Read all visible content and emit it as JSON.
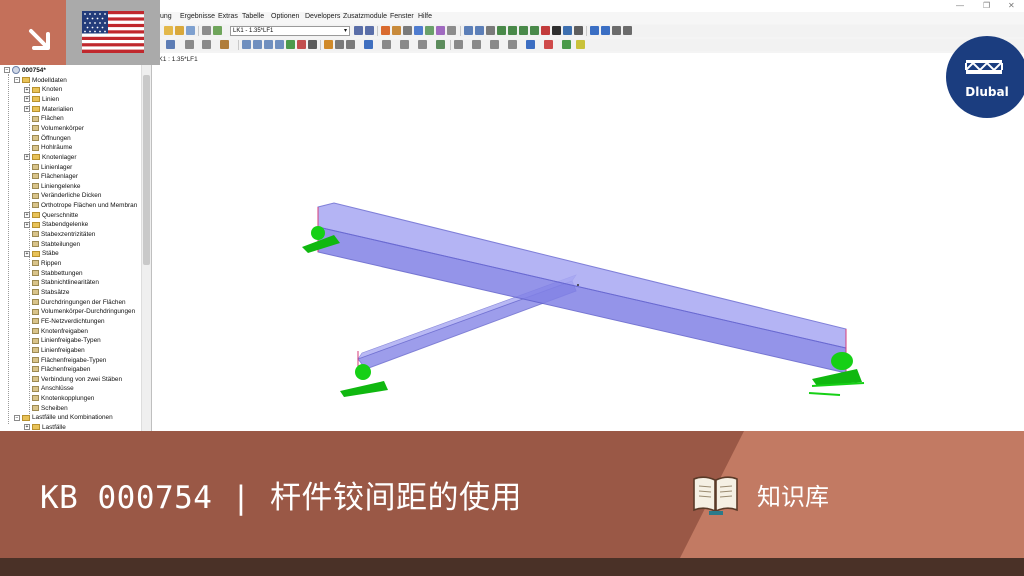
{
  "window": {
    "minimize": "—",
    "restore": "❐",
    "close": "✕"
  },
  "menu": [
    {
      "key": "ergebnisse",
      "label": "Ergebnisse"
    },
    {
      "key": "extras",
      "label": "Extras"
    },
    {
      "key": "tabelle",
      "label": "Tabelle"
    },
    {
      "key": "optionen",
      "label": "Optionen"
    },
    {
      "key": "developers",
      "label": "Developers"
    },
    {
      "key": "zusatzmodule",
      "label": "Zusatzmodule"
    },
    {
      "key": "fenster",
      "label": "Fenster"
    },
    {
      "key": "hilfe",
      "label": "Hilfe"
    }
  ],
  "menu_partial": "ung",
  "toolbar": {
    "load_case_select": "LK1 - 1.35*LF1",
    "dropdown_arrow": "▾"
  },
  "viewport": {
    "label": "LK1 : 1.35*LF1"
  },
  "navigator": {
    "root": "000754*",
    "items": [
      {
        "label": "Modelldaten",
        "level": 1,
        "type": "folder",
        "exp": "−"
      },
      {
        "label": "Knoten",
        "level": 2,
        "type": "folder",
        "exp": "+"
      },
      {
        "label": "Linien",
        "level": 2,
        "type": "folder",
        "exp": "+"
      },
      {
        "label": "Materialien",
        "level": 2,
        "type": "folder",
        "exp": "+"
      },
      {
        "label": "Flächen",
        "level": 2,
        "type": "leaf",
        "exp": ""
      },
      {
        "label": "Volumenkörper",
        "level": 2,
        "type": "leaf",
        "exp": ""
      },
      {
        "label": "Öffnungen",
        "level": 2,
        "type": "leaf",
        "exp": ""
      },
      {
        "label": "Hohlräume",
        "level": 2,
        "type": "leaf",
        "exp": ""
      },
      {
        "label": "Knotenlager",
        "level": 2,
        "type": "folder",
        "exp": "+"
      },
      {
        "label": "Linienlager",
        "level": 2,
        "type": "leaf",
        "exp": ""
      },
      {
        "label": "Flächenlager",
        "level": 2,
        "type": "leaf",
        "exp": ""
      },
      {
        "label": "Liniengelenke",
        "level": 2,
        "type": "leaf",
        "exp": ""
      },
      {
        "label": "Veränderliche Dicken",
        "level": 2,
        "type": "leaf",
        "exp": ""
      },
      {
        "label": "Orthotrope Flächen und Membran",
        "level": 2,
        "type": "leaf",
        "exp": ""
      },
      {
        "label": "Querschnitte",
        "level": 2,
        "type": "folder",
        "exp": "+"
      },
      {
        "label": "Stabendgelenke",
        "level": 2,
        "type": "folder",
        "exp": "+"
      },
      {
        "label": "Stabexzentrizitäten",
        "level": 2,
        "type": "leaf",
        "exp": ""
      },
      {
        "label": "Stabteilungen",
        "level": 2,
        "type": "leaf",
        "exp": ""
      },
      {
        "label": "Stäbe",
        "level": 2,
        "type": "folder",
        "exp": "+"
      },
      {
        "label": "Rippen",
        "level": 2,
        "type": "leaf",
        "exp": ""
      },
      {
        "label": "Stabbettungen",
        "level": 2,
        "type": "leaf",
        "exp": ""
      },
      {
        "label": "Stabnichtlinearitäten",
        "level": 2,
        "type": "leaf",
        "exp": ""
      },
      {
        "label": "Stabsätze",
        "level": 2,
        "type": "leaf",
        "exp": ""
      },
      {
        "label": "Durchdringungen der Flächen",
        "level": 2,
        "type": "leaf",
        "exp": ""
      },
      {
        "label": "Volumenkörper-Durchdringungen",
        "level": 2,
        "type": "leaf",
        "exp": ""
      },
      {
        "label": "FE-Netzverdichtungen",
        "level": 2,
        "type": "leaf",
        "exp": ""
      },
      {
        "label": "Knotenfreigaben",
        "level": 2,
        "type": "leaf",
        "exp": ""
      },
      {
        "label": "Linienfreigabe-Typen",
        "level": 2,
        "type": "leaf",
        "exp": ""
      },
      {
        "label": "Linienfreigaben",
        "level": 2,
        "type": "leaf",
        "exp": ""
      },
      {
        "label": "Flächenfreigabe-Typen",
        "level": 2,
        "type": "leaf",
        "exp": ""
      },
      {
        "label": "Flächenfreigaben",
        "level": 2,
        "type": "leaf",
        "exp": ""
      },
      {
        "label": "Verbindung von zwei Stäben",
        "level": 2,
        "type": "leaf",
        "exp": ""
      },
      {
        "label": "Anschlüsse",
        "level": 2,
        "type": "leaf",
        "exp": ""
      },
      {
        "label": "Knotenkopplungen",
        "level": 2,
        "type": "leaf",
        "exp": ""
      },
      {
        "label": "Scheiben",
        "level": 2,
        "type": "leaf",
        "exp": ""
      },
      {
        "label": "Lastfälle und Kombinationen",
        "level": 1,
        "type": "folder",
        "exp": "−"
      },
      {
        "label": "Lastfälle",
        "level": 2,
        "type": "folder",
        "exp": "+"
      }
    ]
  },
  "banner": {
    "title": "KB 000754 | 杆件铰间距的使用",
    "kb_label": "知识库"
  },
  "logo": {
    "text": "Dlubal"
  },
  "colors": {
    "accent": "#c4705a",
    "banner": "#9a5846",
    "brand_blue": "#1b3d7f",
    "member": "#7d7de8",
    "support": "#12c912"
  },
  "icons": {
    "corner": "arrow-down-right-icon",
    "language": "us-flag-icon",
    "knowledge": "open-book-icon"
  }
}
